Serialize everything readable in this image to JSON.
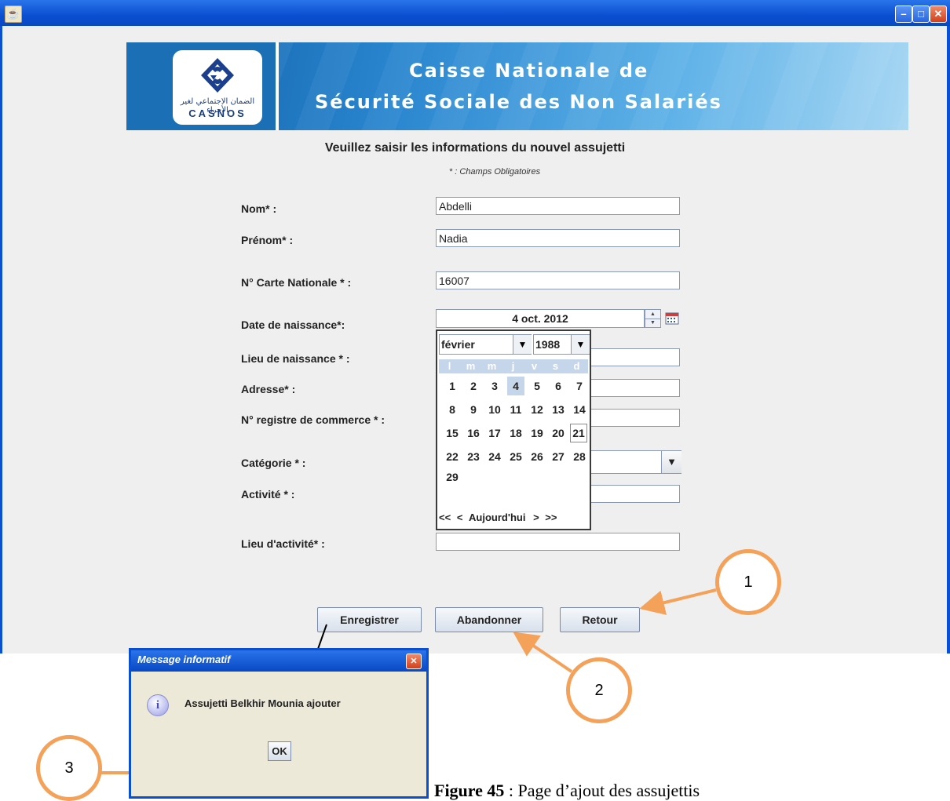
{
  "window": {
    "controls": {
      "minimize": "–",
      "maximize": "□",
      "close": "✕"
    }
  },
  "banner": {
    "line1": "Caisse Nationale de",
    "line2": "Sécurité Sociale des Non Salariés",
    "logo_text": "CASNOS",
    "logo_arabic": "الضمان الاجتماعي لغير الأجراء"
  },
  "form": {
    "title": "Veuillez saisir les informations du nouvel assujetti",
    "note": "* : Champs Obligatoires",
    "labels": {
      "nom": "Nom* :",
      "prenom": "Prénom* :",
      "carte": "N° Carte Nationale * :",
      "date": "Date de naissance*:",
      "lieu_naissance": "Lieu de naissance * :",
      "adresse": "Adresse* :",
      "registre": "N° registre de commerce * :",
      "categorie": "Catégorie * :",
      "activite": "Activité * :",
      "lieu_activite": "Lieu d'activité* :"
    },
    "values": {
      "nom": "Abdelli",
      "prenom": "Nadia",
      "carte": "16007",
      "date": "4 oct. 2012"
    }
  },
  "calendar": {
    "month": "février",
    "year": "1988",
    "weekdays": [
      "l",
      "m",
      "m",
      "j",
      "v",
      "s",
      "d"
    ],
    "days": [
      "1",
      "2",
      "3",
      "4",
      "5",
      "6",
      "7",
      "8",
      "9",
      "10",
      "11",
      "12",
      "13",
      "14",
      "15",
      "16",
      "17",
      "18",
      "19",
      "20",
      "21",
      "22",
      "23",
      "24",
      "25",
      "26",
      "27",
      "28",
      "29"
    ],
    "selected_day": "4",
    "today_day": "21",
    "nav": {
      "first": "<<",
      "prev": "<",
      "today": "Aujourd'hui",
      "next": ">",
      "last": ">>"
    }
  },
  "buttons": {
    "save": "Enregistrer",
    "cancel": "Abandonner",
    "back": "Retour"
  },
  "annotations": {
    "c1": "1",
    "c2": "2",
    "c3": "3"
  },
  "dialog": {
    "title": "Message informatif",
    "message": "Assujetti Belkhir Mounia ajouter",
    "ok": "OK",
    "close": "✕",
    "info_glyph": "i"
  },
  "caption": {
    "bold": "Figure 45",
    "text": " : Page d’ajout des assujettis"
  },
  "colors": {
    "titlebar": "#0a4fd0",
    "annotation": "#f4a15a",
    "banner": "#2a86cf"
  }
}
